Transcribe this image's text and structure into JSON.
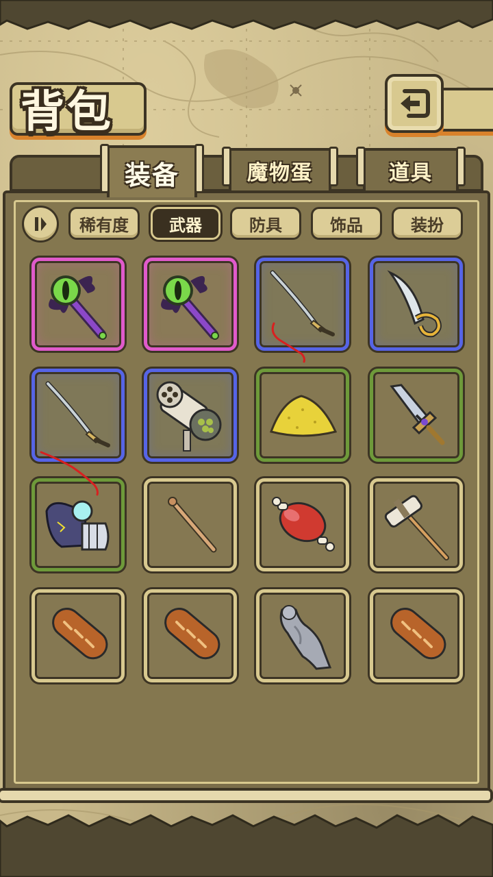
{
  "header": {
    "title": "背包",
    "back_icon": "return-arrow-icon"
  },
  "tabs": [
    {
      "label": "装备",
      "active": true
    },
    {
      "label": "魔物蛋",
      "active": false
    },
    {
      "label": "道具",
      "active": false
    }
  ],
  "filters": {
    "toggle_icon": "pause-toggle-icon",
    "items": [
      {
        "label": "稀有度",
        "active": false
      },
      {
        "label": "武器",
        "active": true
      },
      {
        "label": "防具",
        "active": false
      },
      {
        "label": "饰品",
        "active": false
      },
      {
        "label": "装扮",
        "active": false
      }
    ]
  },
  "colors": {
    "rarity_purple": "#e05acb",
    "rarity_blue": "#5664e6",
    "rarity_green": "#6e9a3a",
    "rarity_common": "#d8c98f",
    "accent_orange": "#d9822b"
  },
  "inventory": [
    {
      "item": "eye-scepter-icon",
      "rarity": "purple"
    },
    {
      "item": "eye-scepter-icon",
      "rarity": "purple"
    },
    {
      "item": "katana-icon",
      "rarity": "blue"
    },
    {
      "item": "cutlass-icon",
      "rarity": "blue"
    },
    {
      "item": "katana-icon",
      "rarity": "blue"
    },
    {
      "item": "gatling-cannon-icon",
      "rarity": "blue"
    },
    {
      "item": "sand-pile-icon",
      "rarity": "green"
    },
    {
      "item": "jeweled-sword-icon",
      "rarity": "green"
    },
    {
      "item": "orb-gauntlet-icon",
      "rarity": "green"
    },
    {
      "item": "wooden-stick-icon",
      "rarity": "common"
    },
    {
      "item": "meat-on-bone-icon",
      "rarity": "common"
    },
    {
      "item": "mop-icon",
      "rarity": "common"
    },
    {
      "item": "bread-loaf-icon",
      "rarity": "common"
    },
    {
      "item": "bread-loaf-icon",
      "rarity": "common"
    },
    {
      "item": "stone-statue-icon",
      "rarity": "common"
    },
    {
      "item": "bread-loaf-icon",
      "rarity": "common"
    }
  ]
}
